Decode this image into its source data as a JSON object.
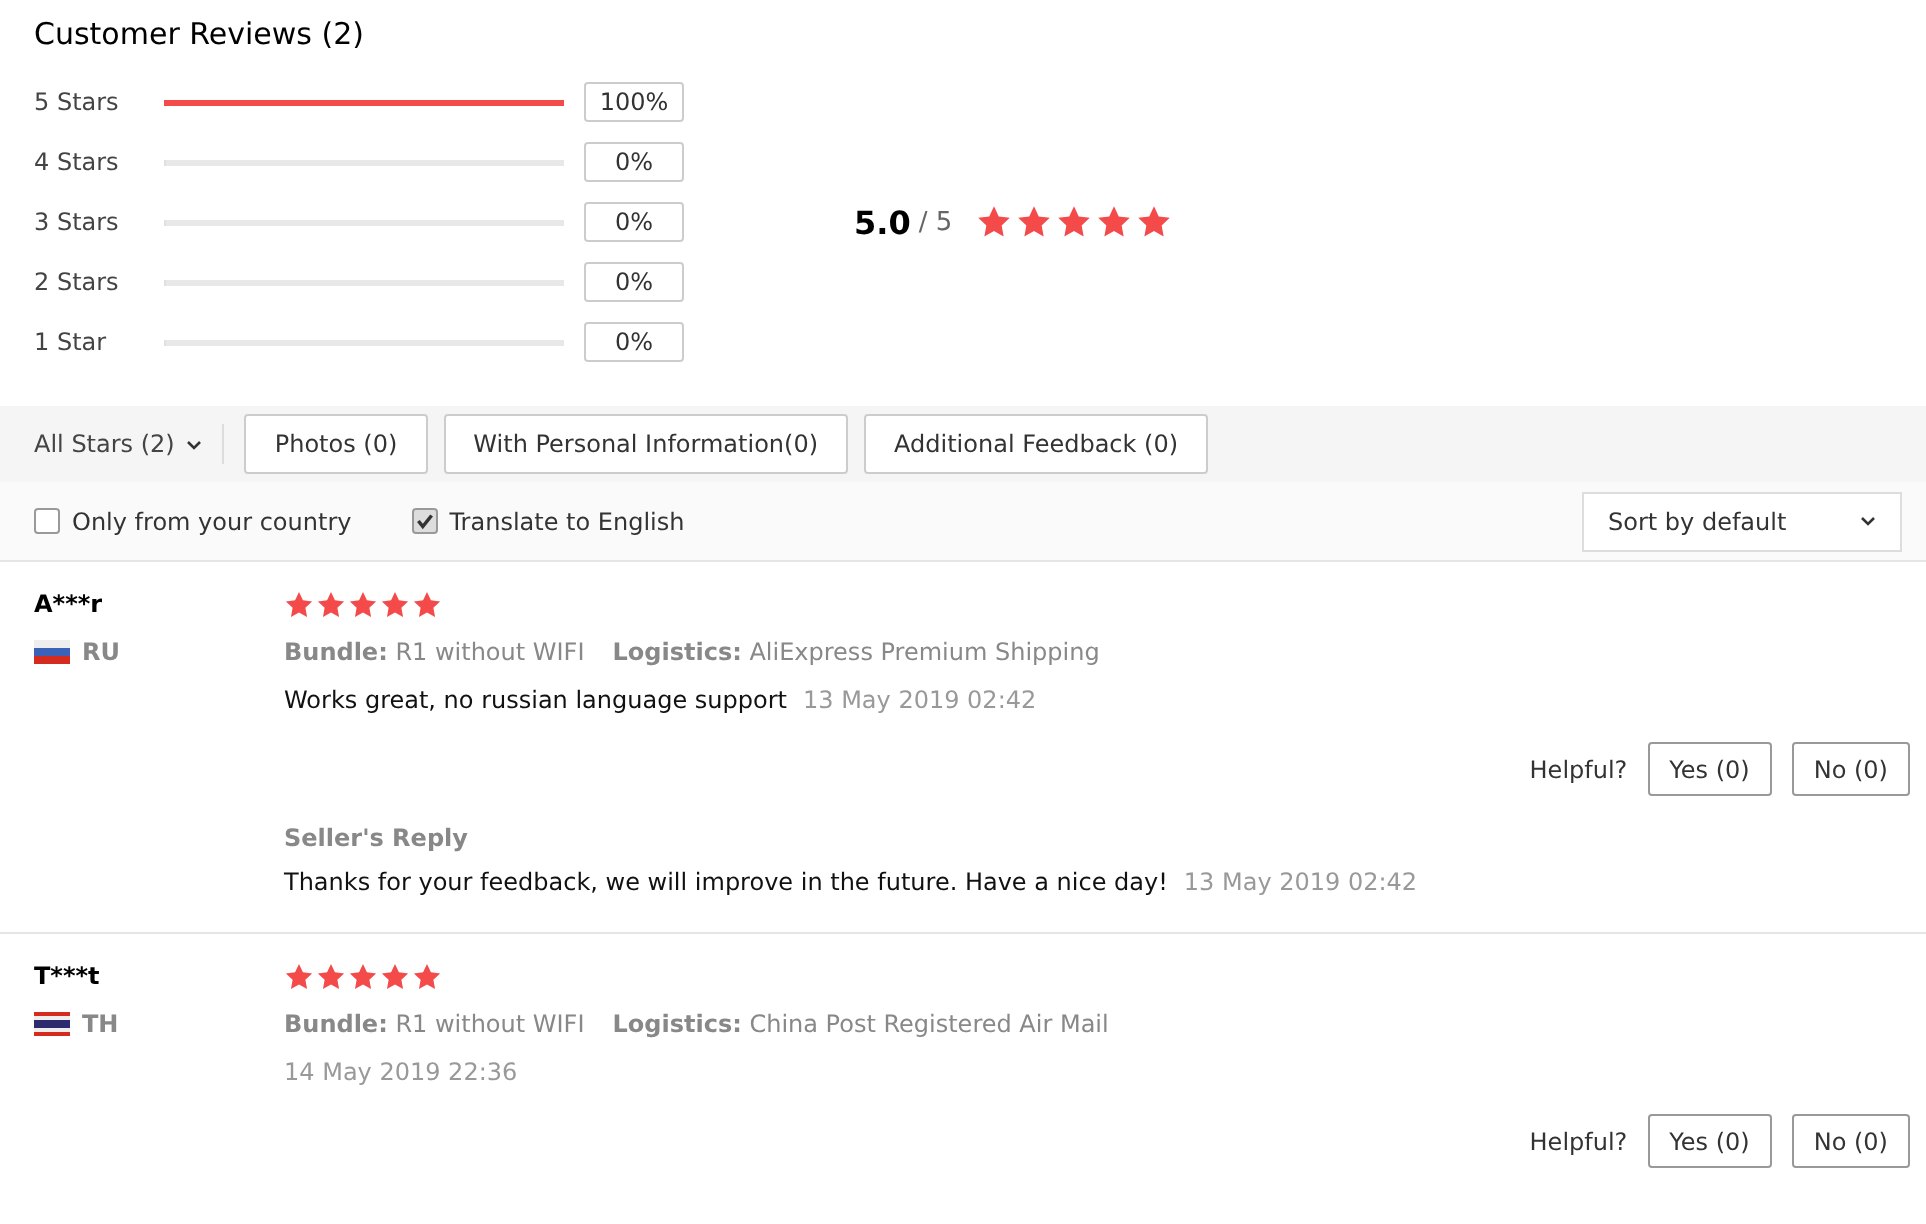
{
  "title": "Customer Reviews (2)",
  "histogram": [
    {
      "label": "5 Stars",
      "level": 1,
      "percent": "100%"
    },
    {
      "label": "4 Stars",
      "level": 0,
      "percent": "0%"
    },
    {
      "label": "3 Stars",
      "level": 0,
      "percent": "0%"
    },
    {
      "label": "2 Stars",
      "level": 0,
      "percent": "0%"
    },
    {
      "label": "1 Star",
      "level": 0,
      "percent": "0%"
    }
  ],
  "rating": {
    "score": "5.0",
    "max": "/ 5",
    "stars": 5
  },
  "filters": {
    "dropdown": "All Stars (2)",
    "buttons": [
      "Photos (0)",
      "With Personal Information(0)",
      "Additional Feedback (0)"
    ]
  },
  "options": [
    {
      "label": "Only from your country",
      "checked": false
    },
    {
      "label": "Translate to English",
      "checked": true
    }
  ],
  "sort": "Sort by default",
  "reviews": [
    {
      "name": "A***r",
      "kind": "tricolor",
      "country": "RU",
      "stars": 5,
      "details": [
        "**Bundle:** R1 without WIFI",
        "**Logistics:** AliExpress Premium Shipping"
      ],
      "text": "Works great, no russian language support",
      "date": "13 May 2019 02:42",
      "helpful": "Helpful?",
      "yes": "Yes (0)",
      "no": "No (0)",
      "reply": {
        "heading": "Seller's Reply",
        "text": "Thanks for your feedback, we will improve in the future. Have a nice day!",
        "date": "13 May 2019 02:42"
      }
    },
    {
      "name": "T***t",
      "kind": "bands",
      "country": "TH",
      "stars": 5,
      "details": [
        "**Bundle:** R1 without WIFI",
        "**Logistics:** China Post Registered Air Mail"
      ],
      "date": "14 May 2019 22:36",
      "helpful": "Helpful?",
      "yes": "Yes (0)",
      "no": "No (0)"
    }
  ]
}
